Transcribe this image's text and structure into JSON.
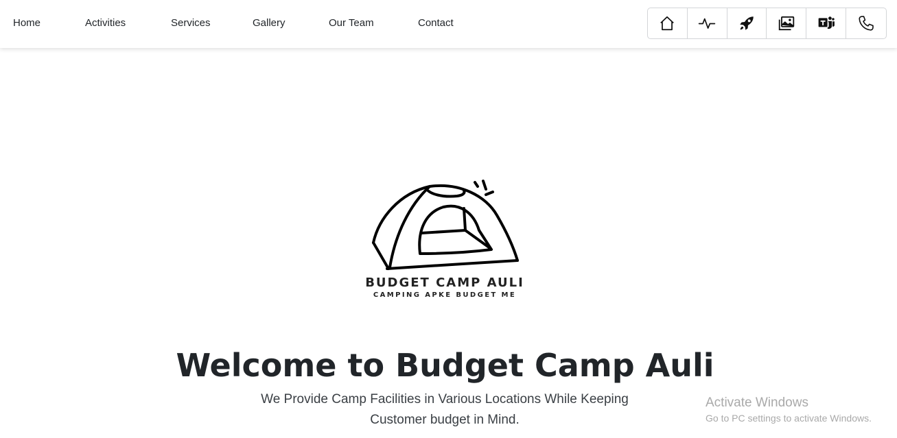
{
  "nav": {
    "links": [
      "Home",
      "Activities",
      "Services",
      "Gallery",
      "Our Team",
      "Contact"
    ]
  },
  "icon_buttons": [
    {
      "icon": "home-icon"
    },
    {
      "icon": "activity-icon"
    },
    {
      "icon": "rocket-icon"
    },
    {
      "icon": "image-icon"
    },
    {
      "icon": "teams-icon"
    },
    {
      "icon": "phone-icon"
    }
  ],
  "logo": {
    "title": "BUDGET CAMP AULI",
    "tagline": "CAMPING APKE BUDGET ME"
  },
  "hero": {
    "heading": "Welcome to Budget Camp Auli",
    "subtitle": "We Provide Camp Facilities in Various Locations While Keeping Customer budget in Mind."
  },
  "watermark": {
    "title": "Activate Windows",
    "subtitle": "Go to PC settings to activate Windows."
  }
}
